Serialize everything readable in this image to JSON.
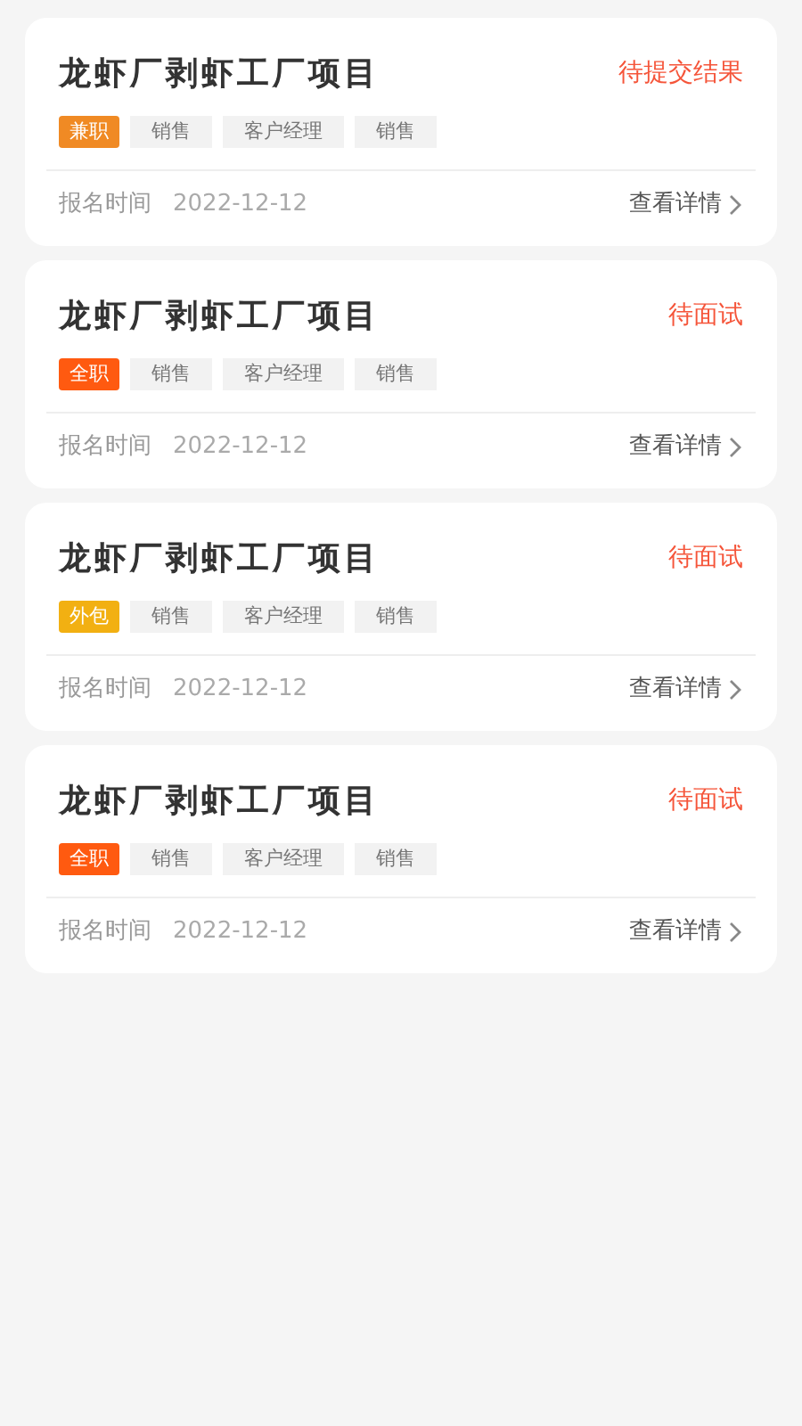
{
  "jobs": [
    {
      "title": "龙虾厂剥虾工厂项目",
      "status": "待提交结果",
      "type_tag": {
        "label": "兼职",
        "color": "#f08a24"
      },
      "tags": [
        "销售",
        "客户经理",
        "销售"
      ],
      "date_label": "报名时间",
      "date": "2022-12-12",
      "details_link": "查看详情"
    },
    {
      "title": "龙虾厂剥虾工厂项目",
      "status": "待面试",
      "type_tag": {
        "label": "全职",
        "color": "#ff5a10"
      },
      "tags": [
        "销售",
        "客户经理",
        "销售"
      ],
      "date_label": "报名时间",
      "date": "2022-12-12",
      "details_link": "查看详情"
    },
    {
      "title": "龙虾厂剥虾工厂项目",
      "status": "待面试",
      "type_tag": {
        "label": "外包",
        "color": "#f2b012"
      },
      "tags": [
        "销售",
        "客户经理",
        "销售"
      ],
      "date_label": "报名时间",
      "date": "2022-12-12",
      "details_link": "查看详情"
    },
    {
      "title": "龙虾厂剥虾工厂项目",
      "status": "待面试",
      "type_tag": {
        "label": "全职",
        "color": "#ff5a10"
      },
      "tags": [
        "销售",
        "客户经理",
        "销售"
      ],
      "date_label": "报名时间",
      "date": "2022-12-12",
      "details_link": "查看详情"
    }
  ]
}
